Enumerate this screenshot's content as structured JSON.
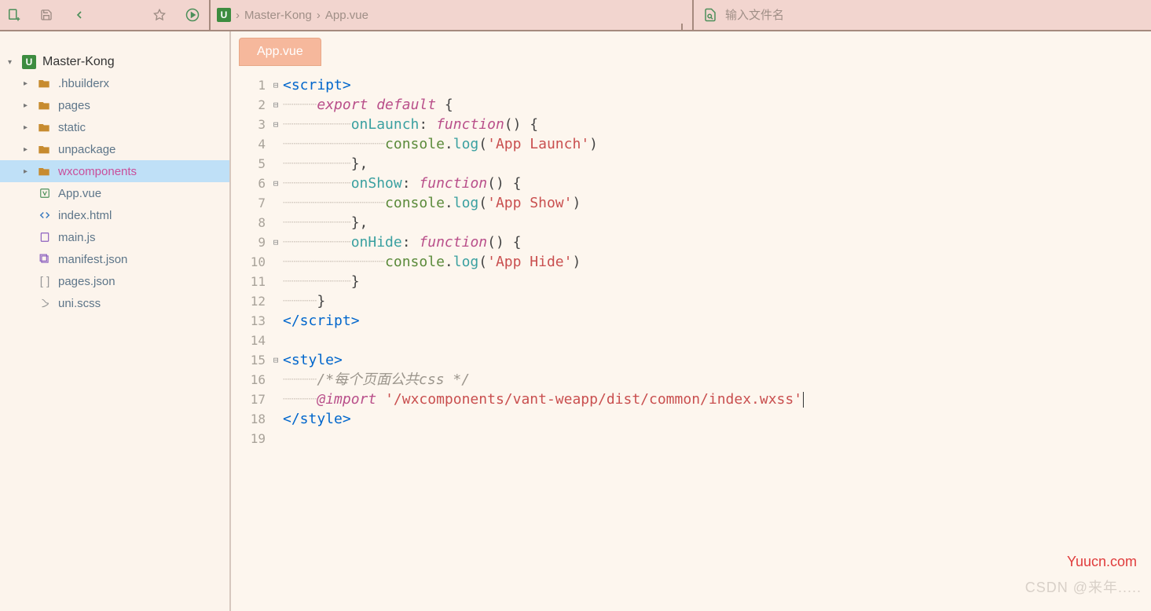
{
  "toolbar": {
    "search_placeholder": "输入文件名"
  },
  "breadcrumb": {
    "root": "Master-Kong",
    "file": "App.vue"
  },
  "sidebar": {
    "project": "Master-Kong",
    "folders": [
      {
        "label": ".hbuilderx",
        "selected": false
      },
      {
        "label": "pages",
        "selected": false
      },
      {
        "label": "static",
        "selected": false
      },
      {
        "label": "unpackage",
        "selected": false
      },
      {
        "label": "wxcomponents",
        "selected": true
      }
    ],
    "files": [
      {
        "label": "App.vue",
        "icon": "vue"
      },
      {
        "label": "index.html",
        "icon": "html"
      },
      {
        "label": "main.js",
        "icon": "js"
      },
      {
        "label": "manifest.json",
        "icon": "manifest"
      },
      {
        "label": "pages.json",
        "icon": "json"
      },
      {
        "label": "uni.scss",
        "icon": "scss"
      }
    ]
  },
  "tab": {
    "label": "App.vue"
  },
  "code": {
    "l1": "<script>",
    "l2_kw": "export default",
    "l3_prop": "onLaunch",
    "func_kw": "function",
    "l4_obj": "console",
    "l4_method": "log",
    "l4_str": "'App Launch'",
    "l6_prop": "onShow",
    "l7_str": "'App Show'",
    "l9_prop": "onHide",
    "l10_str": "'App Hide'",
    "l13": "</script>",
    "l15": "<style>",
    "l16_comment": "/*每个页面公共css */",
    "l17_import": "@import",
    "l17_str": "'/wxcomponents/vant-weapp/dist/common/index.wxss'",
    "l18": "</style>"
  },
  "line_numbers": [
    "1",
    "2",
    "3",
    "4",
    "5",
    "6",
    "7",
    "8",
    "9",
    "10",
    "11",
    "12",
    "13",
    "14",
    "15",
    "16",
    "17",
    "18",
    "19"
  ],
  "watermarks": {
    "w1": "Yuucn.com",
    "w2": "CSDN @来年....."
  }
}
